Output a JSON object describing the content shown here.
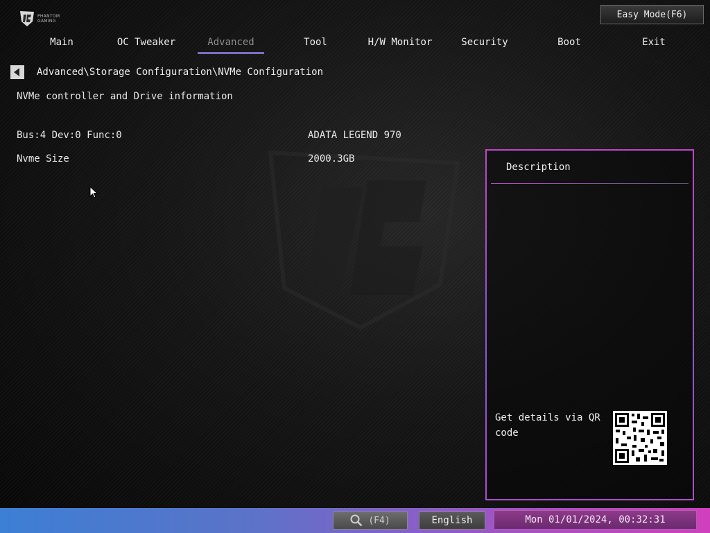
{
  "brand": {
    "line1": "PHANTOM",
    "line2": "GAMING"
  },
  "easy_mode_label": "Easy Mode(F6)",
  "tabs": [
    {
      "label": "Main",
      "active": false
    },
    {
      "label": "OC Tweaker",
      "active": false
    },
    {
      "label": "Advanced",
      "active": true
    },
    {
      "label": "Tool",
      "active": false
    },
    {
      "label": "H/W Monitor",
      "active": false
    },
    {
      "label": "Security",
      "active": false
    },
    {
      "label": "Boot",
      "active": false
    },
    {
      "label": "Exit",
      "active": false
    }
  ],
  "breadcrumb": "Advanced\\Storage Configuration\\NVMe Configuration",
  "section_title": "NVMe controller and Drive information",
  "rows": [
    {
      "label": "Bus:4 Dev:0 Func:0",
      "value": "ADATA LEGEND 970"
    },
    {
      "label": "Nvme Size",
      "value": "2000.3GB"
    }
  ],
  "description": {
    "title": "Description",
    "qr_text": "Get details via QR code"
  },
  "bottom": {
    "search_label": "(F4)",
    "language": "English",
    "datetime": "Mon 01/01/2024, 00:32:31"
  },
  "colors": {
    "active_tab_underline": "#7b6fc4",
    "panel_border": "#c046c8"
  }
}
